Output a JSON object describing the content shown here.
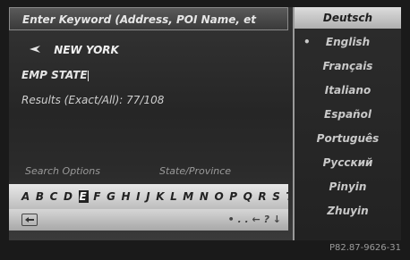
{
  "search": {
    "keyword_field": "Enter Keyword (Address, POI Name, et",
    "location": "NEW YORK",
    "current_entry": "EMP STATE",
    "results": "Results (Exact/All): 77/108"
  },
  "options": {
    "search_options": "Search Options",
    "state_province": "State/Province"
  },
  "keyboard": {
    "before": "A B C D ",
    "selected": "E",
    "after": " F G H I J K L M N O P Q R S T U"
  },
  "controls": {
    "symbols": "•  ․  ․  ← ? ↓"
  },
  "menu": {
    "header": "Deutsch",
    "items": [
      "English",
      "Français",
      "Italiano",
      "Español",
      "Português",
      "Русский",
      "Pinyin",
      "Zhuyin"
    ]
  },
  "caption": "P82.87-9626-31"
}
